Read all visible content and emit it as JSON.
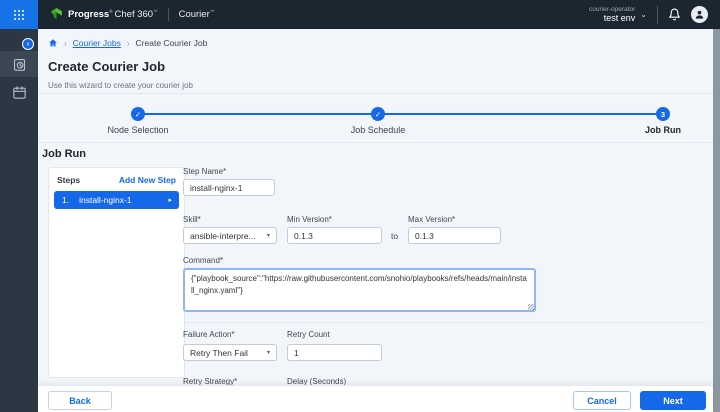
{
  "topbar": {
    "brand": {
      "company": "Progress",
      "company_mark": "®",
      "suite": "Chef 360",
      "suite_mark": "™",
      "app": "Courier",
      "app_mark": "™"
    },
    "account": {
      "role": "courier-operator",
      "environment": "test env",
      "caret": "⌄"
    }
  },
  "breadcrumb": {
    "separator": "›",
    "items": [
      {
        "label": "Courier Jobs"
      },
      {
        "label": "Create Courier Job"
      }
    ]
  },
  "page": {
    "title": "Create Courier Job",
    "subtitle": "Use this wizard to create your courier job"
  },
  "stepper": {
    "steps": [
      {
        "label": "Node Selection",
        "status": "complete",
        "glyph": "✓"
      },
      {
        "label": "Job Schedule",
        "status": "complete",
        "glyph": "✓"
      },
      {
        "label": "Job Run",
        "status": "current",
        "glyph": "3"
      }
    ]
  },
  "job_run": {
    "heading": "Job Run"
  },
  "steps_panel": {
    "title": "Steps",
    "add_new": "Add New Step",
    "selected_step": {
      "index": "1.",
      "name": "install-nginx-1",
      "chevron": "▸"
    }
  },
  "form": {
    "step_name": {
      "label": "Step Name*",
      "value": "install-nginx-1"
    },
    "skill": {
      "label": "Skill*",
      "value": "ansible-interpre...",
      "caret": "▾"
    },
    "min_version": {
      "label": "Min Version*",
      "value": "0.1.3"
    },
    "range_join": "to",
    "max_version": {
      "label": "Max Version*",
      "value": "0.1.3"
    },
    "command": {
      "label": "Command*",
      "value": "{\"playbook_source\":\"https://raw.githubusercontent.com/snohio/playbooks/refs/heads/main/install_nginx.yaml\"}"
    },
    "failure_action": {
      "label": "Failure Action*",
      "value": "Retry Then Fail",
      "caret": "▾"
    },
    "retry_count": {
      "label": "Retry Count",
      "value": "1"
    },
    "retry_strategy": {
      "label": "Retry Strategy*"
    },
    "delay": {
      "label": "Delay (Seconds)"
    }
  },
  "footer": {
    "back": "Back",
    "cancel": "Cancel",
    "next": "Next"
  },
  "colors": {
    "accent": "#1569e8",
    "topbar_bg": "#1c2630",
    "sidebar_bg": "#2c3743",
    "page_bg": "#f2f5f9"
  }
}
